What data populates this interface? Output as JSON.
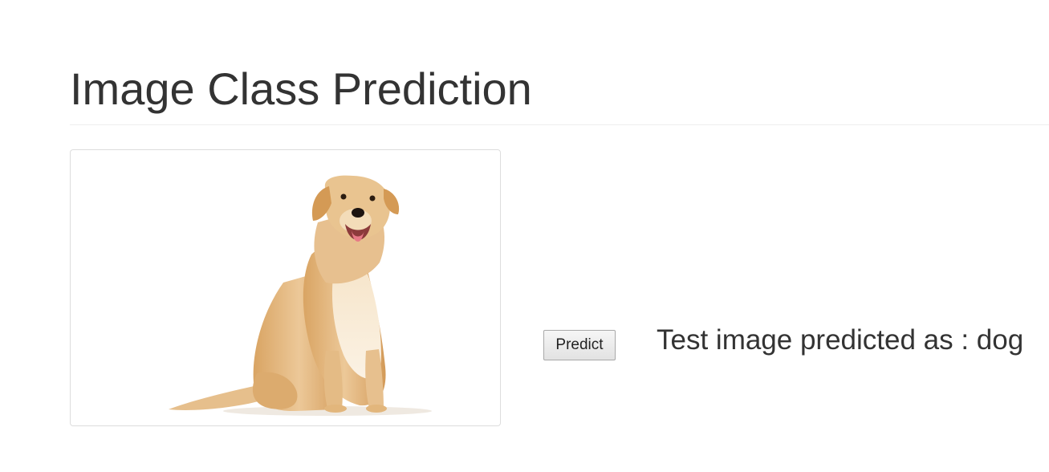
{
  "page": {
    "title": "Image Class Prediction"
  },
  "image": {
    "subject": "dog-photo",
    "border_color": "#dddddd"
  },
  "controls": {
    "predict_label": "Predict"
  },
  "result": {
    "text": "Test image predicted as : dog"
  },
  "colors": {
    "text": "#333333",
    "divider": "#eeeeee",
    "dog_fur": "#e2b67c"
  }
}
